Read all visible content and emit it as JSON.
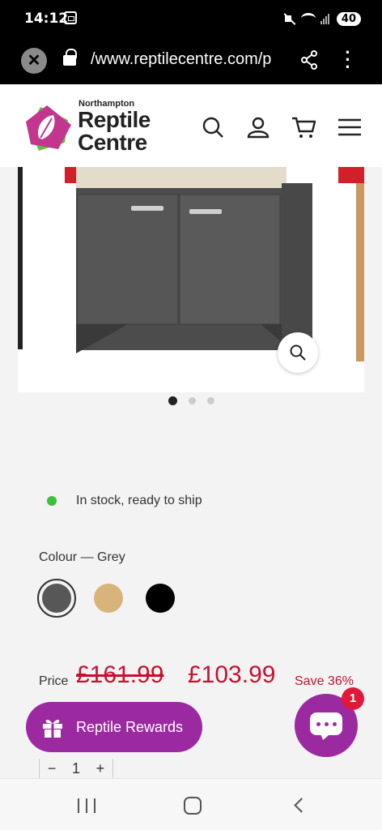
{
  "status_bar": {
    "time": "14:12",
    "battery": "40"
  },
  "browser": {
    "url": "/www.reptilecentre.com/p"
  },
  "logo": {
    "line_small": "Northampton",
    "line_1": "Reptile",
    "line_2": "Centre"
  },
  "header_icons": [
    "search-icon",
    "account-icon",
    "cart-icon",
    "menu-icon"
  ],
  "gallery": {
    "slide_count": 3,
    "active_slide": 1
  },
  "stock": {
    "text": "In stock, ready to ship",
    "color": "#3cc13b"
  },
  "colour": {
    "label": "Colour — Grey",
    "options": [
      {
        "name": "Grey",
        "swatch": "#575757",
        "selected": true
      },
      {
        "name": "Oak",
        "swatch": "#d8b47a",
        "selected": false
      },
      {
        "name": "Black",
        "swatch": "#000000",
        "selected": false
      }
    ]
  },
  "price": {
    "label": "Price",
    "old": "£161.99",
    "new": "£103.99",
    "save": "Save 36%",
    "color": "#c8102e"
  },
  "quantity": {
    "minus": "−",
    "value": "1",
    "plus": "+"
  },
  "rewards": {
    "label": "Reptile Rewards",
    "color": "#9b2aa1"
  },
  "chat": {
    "badge": "1"
  }
}
